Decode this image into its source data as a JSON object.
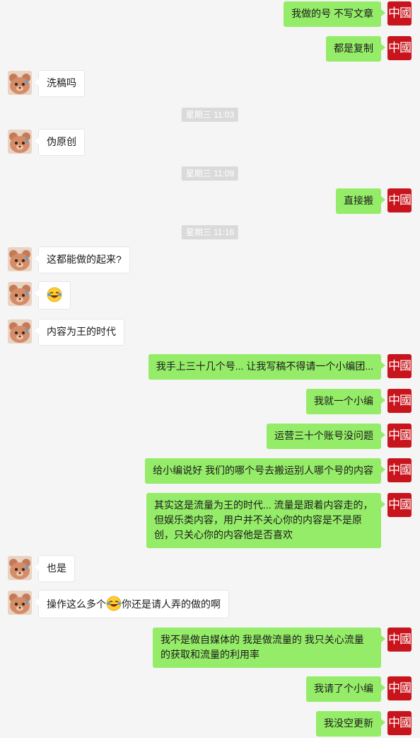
{
  "right_avatar_text": "中國",
  "messages": {
    "m1": "我做的号 不写文章",
    "m2": "都是复制",
    "m3": "洗稿吗",
    "t1": "星期三 11:03",
    "m4": "伪原创",
    "t2": "星期三 11:09",
    "m5": "直接搬",
    "t3": "星期三 11:16",
    "m6": "这都能做的起来?",
    "m8": "内容为王的时代",
    "m9": "我手上三十几个号... 让我写稿不得请一个小编团...",
    "m10": "我就一个小编",
    "m11": "运营三十个账号没问题",
    "m12": "给小编说好 我们的哪个号去搬运别人哪个号的内容",
    "m13": "其实这是流量为王的时代... 流量是跟着内容走的，但娱乐类内容，用户并不关心你的内容是不是原创，只关心你的内容他是否喜欢",
    "m14": "也是",
    "m15a": "操作这么多个",
    "m15b": "你还是请人弄的做的啊",
    "m16": "我不是做自媒体的 我是做流量的 我只关心流量的获取和流量的利用率",
    "m17": "我请了个小编",
    "m18": "我没空更新"
  },
  "colors": {
    "right_bubble": "#95ec69",
    "left_bubble": "#ffffff",
    "avatar_red": "#c8141c",
    "background": "#f5f5f5"
  },
  "icons": {
    "left_avatar": "bear-sticker-avatar",
    "emoji": "laughing-tears-emoji"
  }
}
